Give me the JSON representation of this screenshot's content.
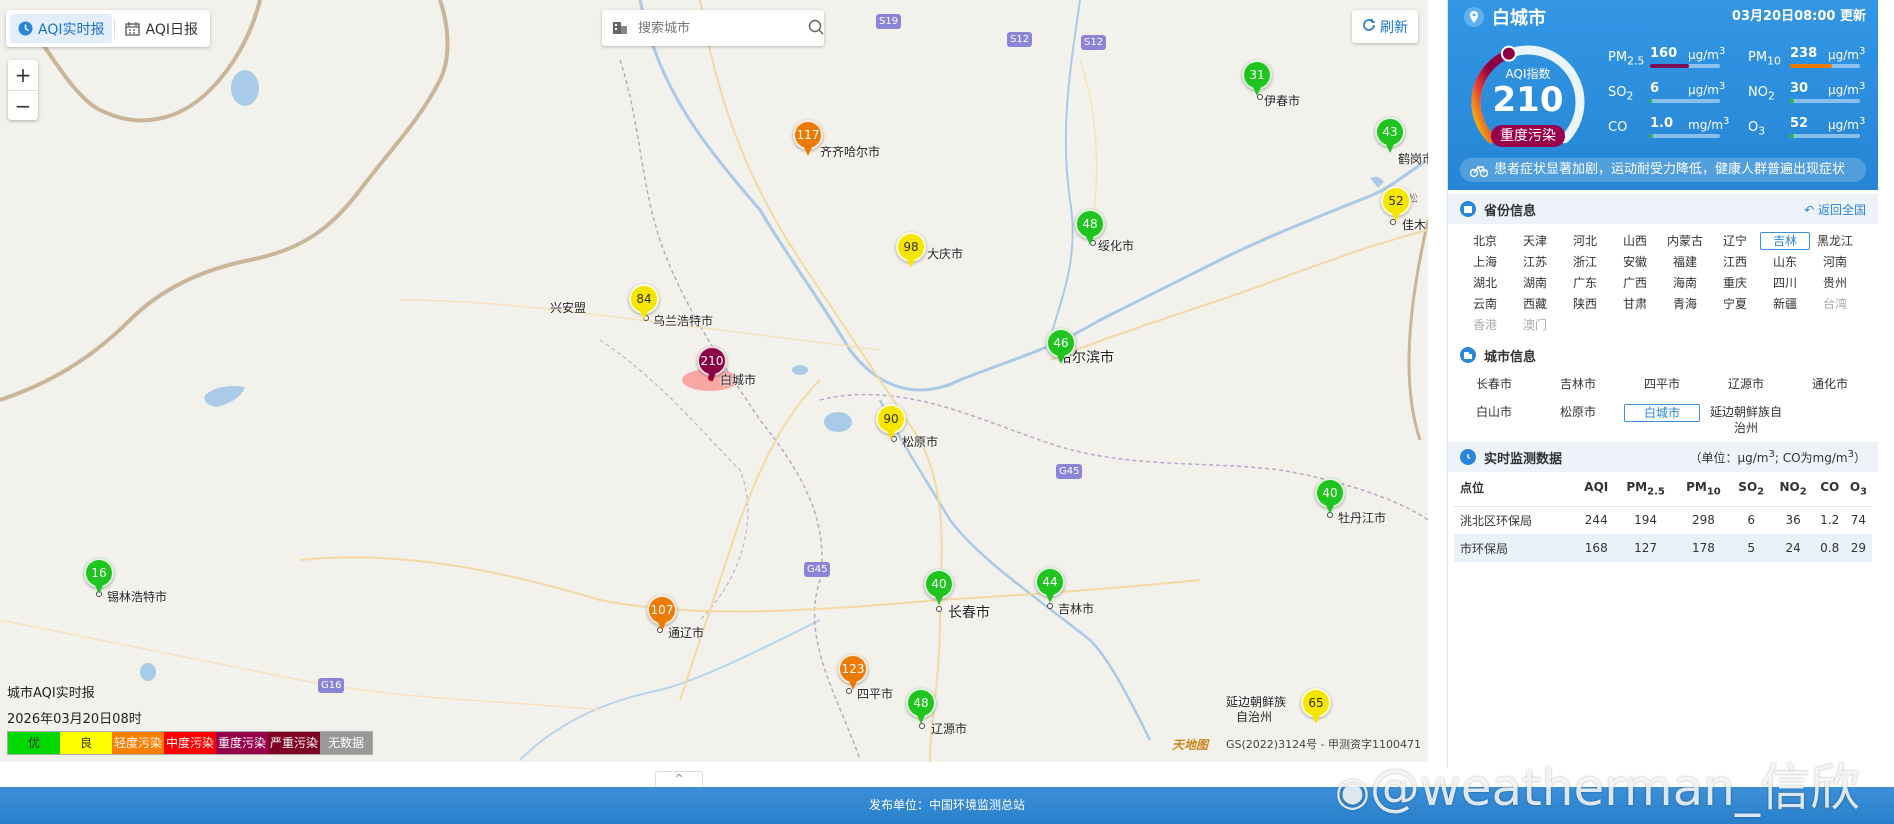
{
  "tabs": [
    {
      "label": "AQI实时报",
      "active": true
    },
    {
      "label": "AQI日报",
      "active": false
    }
  ],
  "search": {
    "placeholder": "搜索城市"
  },
  "refresh_label": "刷新",
  "zoom": {
    "in": "+",
    "out": "−"
  },
  "road_labels": [
    "S19",
    "S12",
    "S12",
    "G45",
    "G45",
    "G16"
  ],
  "markers": [
    {
      "aqi": "31",
      "color": "#1fc41f",
      "text_color": "#fff"
    },
    {
      "aqi": "43",
      "color": "#1fc41f",
      "text_color": "#fff"
    },
    {
      "aqi": "117",
      "color": "#ee7a06",
      "text_color": "#fff"
    },
    {
      "aqi": "52",
      "color": "#f5e600",
      "text_color": "#333"
    },
    {
      "aqi": "48",
      "color": "#1fc41f",
      "text_color": "#fff"
    },
    {
      "aqi": "98",
      "color": "#f5e600",
      "text_color": "#333"
    },
    {
      "aqi": "84",
      "color": "#f5e600",
      "text_color": "#333"
    },
    {
      "aqi": "46",
      "color": "#1fc41f",
      "text_color": "#fff"
    },
    {
      "aqi": "210",
      "color": "#8b0045",
      "text_color": "#fff"
    },
    {
      "aqi": "90",
      "color": "#f5e600",
      "text_color": "#333"
    },
    {
      "aqi": "40",
      "color": "#1fc41f",
      "text_color": "#fff"
    },
    {
      "aqi": "16",
      "color": "#1fc41f",
      "text_color": "#fff"
    },
    {
      "aqi": "107",
      "color": "#ee7a06",
      "text_color": "#fff"
    },
    {
      "aqi": "40",
      "color": "#1fc41f",
      "text_color": "#fff"
    },
    {
      "aqi": "44",
      "color": "#1fc41f",
      "text_color": "#fff"
    },
    {
      "aqi": "123",
      "color": "#ee7a06",
      "text_color": "#fff"
    },
    {
      "aqi": "48",
      "color": "#1fc41f",
      "text_color": "#fff"
    },
    {
      "aqi": "65",
      "color": "#f5e600",
      "text_color": "#333"
    }
  ],
  "cities": [
    "伊春市",
    "鹤岗市",
    "齐齐哈尔市",
    "佳木",
    "绥化市",
    "大庆市",
    "兴安盟",
    "乌兰浩特市",
    "哈尔滨市",
    "白城市",
    "松原市",
    "牡丹江市",
    "锡林浩特市",
    "通辽市",
    "长春市",
    "吉林市",
    "四平市",
    "辽源市",
    "延边朝鲜族",
    "自治州",
    "松"
  ],
  "legend": {
    "title": "城市AQI实时报",
    "date": "2026年03月20日08时",
    "items": [
      {
        "label": "优",
        "color": "#00d800",
        "text_color": "#333"
      },
      {
        "label": "良",
        "color": "#ffff00",
        "text_color": "#333"
      },
      {
        "label": "轻度污染",
        "color": "#ff7e00",
        "text_color": "#fff"
      },
      {
        "label": "中度污染",
        "color": "#ff0000",
        "text_color": "#fff"
      },
      {
        "label": "重度污染",
        "color": "#99004c",
        "text_color": "#fff"
      },
      {
        "label": "严重污染",
        "color": "#7e0023",
        "text_color": "#fff"
      },
      {
        "label": "无数据",
        "color": "#999999",
        "text_color": "#fff"
      }
    ]
  },
  "map_credit": {
    "logo": "天地图",
    "gs": "GS(2022)3124号 - 甲测资字1100471"
  },
  "footer": {
    "publisher": "发布单位：中国环境监测总站",
    "collapse": "^"
  },
  "watermark": "@weatherman_信欣",
  "panel": {
    "city": "白城市",
    "update": "03月20日08:00 更新",
    "aqi_label": "AQI指数",
    "aqi": "210",
    "aqi_fraction": 0.42,
    "level": "重度污染",
    "level_color": "#99004c",
    "pollutants": [
      {
        "name": "PM",
        "sub": "2.5",
        "value": "160",
        "unit": "μg/m",
        "sup": "3",
        "fill": 0.55,
        "color": "#7a0d56"
      },
      {
        "name": "PM",
        "sub": "10",
        "value": "238",
        "unit": "μg/m",
        "sup": "3",
        "fill": 0.6,
        "color": "#ee7a06"
      },
      {
        "name": "SO",
        "sub": "2",
        "value": "6",
        "unit": "μg/m",
        "sup": "3",
        "fill": 0.03,
        "color": "#1fc41f"
      },
      {
        "name": "NO",
        "sub": "2",
        "value": "30",
        "unit": "μg/m",
        "sup": "3",
        "fill": 0.06,
        "color": "#1fc41f"
      },
      {
        "name": "CO",
        "sub": "",
        "value": "1.0",
        "unit": "mg/m",
        "sup": "3",
        "fill": 0.04,
        "color": "#1fc41f"
      },
      {
        "name": "O",
        "sub": "3",
        "value": "52",
        "unit": "μg/m",
        "sup": "3",
        "fill": 0.05,
        "color": "#1fc41f"
      }
    ],
    "advice": "患者症状显著加剧，运动耐受力降低，健康人群普遍出现症状",
    "province_title": "省份信息",
    "back_all": "返回全国",
    "provinces": [
      {
        "n": "北京"
      },
      {
        "n": "天津"
      },
      {
        "n": "河北"
      },
      {
        "n": "山西"
      },
      {
        "n": "内蒙古"
      },
      {
        "n": "辽宁"
      },
      {
        "n": "吉林",
        "sel": true
      },
      {
        "n": "黑龙江"
      },
      {
        "n": "上海"
      },
      {
        "n": "江苏"
      },
      {
        "n": "浙江"
      },
      {
        "n": "安徽"
      },
      {
        "n": "福建"
      },
      {
        "n": "江西"
      },
      {
        "n": "山东"
      },
      {
        "n": "河南"
      },
      {
        "n": "湖北"
      },
      {
        "n": "湖南"
      },
      {
        "n": "广东"
      },
      {
        "n": "广西"
      },
      {
        "n": "海南"
      },
      {
        "n": "重庆"
      },
      {
        "n": "四川"
      },
      {
        "n": "贵州"
      },
      {
        "n": "云南"
      },
      {
        "n": "西藏"
      },
      {
        "n": "陕西"
      },
      {
        "n": "甘肃"
      },
      {
        "n": "青海"
      },
      {
        "n": "宁夏"
      },
      {
        "n": "新疆"
      },
      {
        "n": "台湾",
        "dis": true
      },
      {
        "n": "香港",
        "dis": true
      },
      {
        "n": "澳门",
        "dis": true
      }
    ],
    "city_title": "城市信息",
    "city_list": [
      {
        "n": "长春市"
      },
      {
        "n": "吉林市"
      },
      {
        "n": "四平市"
      },
      {
        "n": "辽源市"
      },
      {
        "n": "通化市"
      },
      {
        "n": "白山市"
      },
      {
        "n": "松原市"
      },
      {
        "n": "白城市",
        "sel": true
      },
      {
        "n": "延边朝鲜族自治州"
      }
    ],
    "monitor_title": "实时监测数据",
    "monitor_unit_a": "（单位：μg/m",
    "monitor_unit_b": "; CO为mg/m",
    "monitor_unit_c": "）",
    "sup3": "3",
    "table": {
      "headers": [
        {
          "n": "点位",
          "s": ""
        },
        {
          "n": "AQI",
          "s": ""
        },
        {
          "n": "PM",
          "s": "2.5"
        },
        {
          "n": "PM",
          "s": "10"
        },
        {
          "n": "SO",
          "s": "2"
        },
        {
          "n": "NO",
          "s": "2"
        },
        {
          "n": "CO",
          "s": ""
        },
        {
          "n": "O",
          "s": "3"
        }
      ],
      "rows": [
        [
          "洮北区环保局",
          "244",
          "194",
          "298",
          "6",
          "36",
          "1.2",
          "74"
        ],
        [
          "市环保局",
          "168",
          "127",
          "178",
          "5",
          "24",
          "0.8",
          "29"
        ]
      ]
    }
  }
}
